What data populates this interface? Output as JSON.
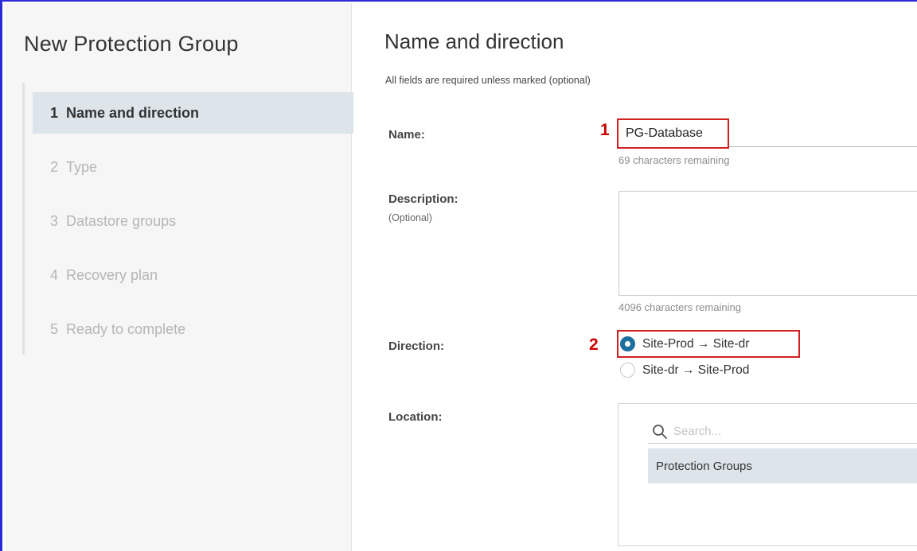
{
  "wizard": {
    "title": "New Protection Group",
    "steps": [
      {
        "num": "1",
        "label": "Name and direction",
        "active": true
      },
      {
        "num": "2",
        "label": "Type",
        "active": false
      },
      {
        "num": "3",
        "label": "Datastore groups",
        "active": false
      },
      {
        "num": "4",
        "label": "Recovery plan",
        "active": false
      },
      {
        "num": "5",
        "label": "Ready to complete",
        "active": false
      }
    ]
  },
  "main": {
    "title": "Name and direction",
    "subtitle": "All fields are required unless marked (optional)",
    "name": {
      "label": "Name:",
      "value": "PG-Database",
      "hint": "69 characters remaining",
      "callout": "1"
    },
    "description": {
      "label": "Description:",
      "sublabel": "(Optional)",
      "value": "",
      "hint": "4096 characters remaining"
    },
    "direction": {
      "label": "Direction:",
      "callout": "2",
      "options": [
        {
          "label": "Site-Prod → Site-dr",
          "checked": true
        },
        {
          "label": "Site-dr → Site-Prod",
          "checked": false
        }
      ]
    },
    "location": {
      "label": "Location:",
      "search_placeholder": "Search...",
      "items": [
        "Protection Groups"
      ]
    }
  },
  "colors": {
    "accent": "#1d6f9f",
    "callout_red": "#cc0000",
    "active_step_bg": "#dde4ea",
    "frame_blue": "#2b2bd9"
  }
}
